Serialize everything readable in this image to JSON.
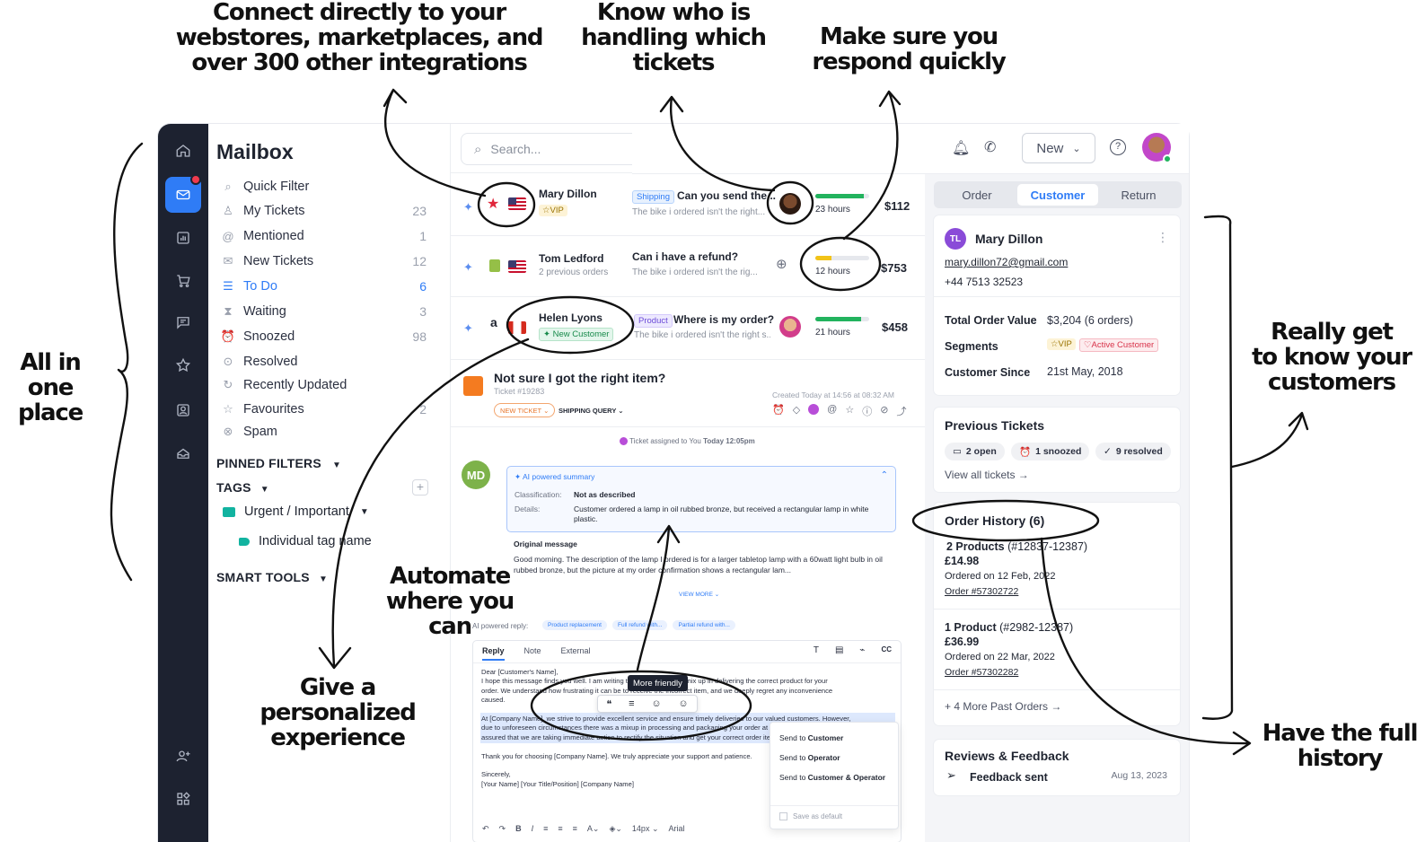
{
  "callouts": {
    "integrations": [
      "Connect directly to your",
      "webstores, marketplaces, and",
      "over 300 other integrations"
    ],
    "handling": [
      "Know who is",
      "handling which",
      "tickets"
    ],
    "respond": [
      "Make sure you",
      "respond quickly"
    ],
    "all_in_one": [
      "All in one",
      "place"
    ],
    "really_know": [
      "Really get",
      "to know your",
      "customers"
    ],
    "automate": [
      "Automate",
      "where you can"
    ],
    "personalized": [
      "Give a",
      "personalized",
      "experience"
    ],
    "full_history": [
      "Have the full",
      "history"
    ]
  },
  "mailbox": {
    "title": "Mailbox",
    "items": [
      {
        "icon": "search-icon",
        "label": "Quick Filter",
        "count": ""
      },
      {
        "icon": "user-icon",
        "label": "My Tickets",
        "count": "23"
      },
      {
        "icon": "at-icon",
        "label": "Mentioned",
        "count": "1"
      },
      {
        "icon": "mail-icon",
        "label": "New Tickets",
        "count": "12"
      },
      {
        "icon": "list-icon",
        "label": "To Do",
        "count": "6"
      },
      {
        "icon": "hourglass-icon",
        "label": "Waiting",
        "count": "3"
      },
      {
        "icon": "alarm-icon",
        "label": "Snoozed",
        "count": "98"
      },
      {
        "icon": "check-circle-icon",
        "label": "Resolved",
        "count": ""
      },
      {
        "icon": "history-icon",
        "label": "Recently Updated",
        "count": ""
      },
      {
        "icon": "star-icon",
        "label": "Favourites",
        "count": "2"
      },
      {
        "icon": "ban-icon",
        "label": "Spam",
        "count": ""
      }
    ],
    "selected_index": 4,
    "pinned_filters": "PINNED FILTERS",
    "tags": "TAGS",
    "tag_items": [
      "Urgent / Important",
      "Individual tag name"
    ],
    "smart_tools": "SMART TOOLS"
  },
  "search": {
    "placeholder": "Search..."
  },
  "header": {
    "new_button": "New"
  },
  "tickets": [
    {
      "name": "Mary Dillon",
      "badge": "VIP",
      "tag": "Shipping",
      "subject": "Can you send the...",
      "preview": "The bike i ordered isn't the right...",
      "sla": "23 hours",
      "sla_fill": 0.9,
      "sla_color": "#22b35e",
      "price": "$112"
    },
    {
      "name": "Tom Ledford",
      "sub": "2 previous orders",
      "subject": "Can i have a refund?",
      "preview": "The bike i ordered isn't the rig...",
      "sla": "12 hours",
      "sla_fill": 0.3,
      "sla_color": "#f2c318",
      "price": "$753"
    },
    {
      "name": "Helen Lyons",
      "badge": "New Customer",
      "tag": "Product",
      "subject": "Where is my order?",
      "preview": "The bike i ordered isn't the right s...",
      "sla": "21 hours",
      "sla_fill": 0.85,
      "sla_color": "#22b35e",
      "price": "$458"
    }
  ],
  "open_ticket": {
    "title": "Not sure I got the right item?",
    "number": "Ticket #19283",
    "created": "Created Today at 14:56 at 08:32 AM",
    "status": "NEW TICKET",
    "category": "SHIPPING QUERY",
    "assigned": "Ticket assigned to You",
    "assigned_time": "Today 12:05pm",
    "author_initials": "MD",
    "summary_title": "AI powered summary",
    "classification_label": "Classification:",
    "classification_value": "Not as described",
    "details_label": "Details:",
    "details_value": "Customer ordered a lamp in oil rubbed bronze, but received a rectangular lamp in white plastic.",
    "original_label": "Original message",
    "original_text": "Good morning. The description of the lamp I ordered is for a larger tabletop lamp with a 60watt light bulb in oil rubbed bronze, but the picture at my order confirmation shows a rectangular lam...",
    "view_more": "VIEW MORE",
    "ai_reply_label": "AI powered reply:",
    "ai_chips": [
      "Product replacement",
      "Full refund with...",
      "Partial refund with..."
    ],
    "reply_tabs": [
      "Reply",
      "Note",
      "External"
    ],
    "reply_lines": [
      "Dear [Customer's Name],",
      "I hope this message finds you well. I am writing to apologize for the mix up in delivering the correct product for your",
      "order. We understand how frustrating it can be to receive the incorrect item, and we deeply regret any inconvenience",
      "caused.",
      "",
      "At [Company Name], we strive to provide excellent service and ensure timely deliveries to our valued customers. However,",
      "due to unforeseen circumstances there was a mixup in processing and packaging your order at our warehouse. Please be",
      "assured that we are taking immediate action to rectify the situation and get your correct order item to you as soon as possible.",
      "",
      "Thank you for choosing [Company Name]. We truly appreciate your support and patience.",
      "",
      "Sincerely,",
      "[Your Name] [Your Title/Position] [Company Name]"
    ],
    "tooltip": "More friendly",
    "send_options": [
      {
        "prefix": "Send to ",
        "target": "Customer"
      },
      {
        "prefix": "Send to ",
        "target": "Operator"
      },
      {
        "prefix": "Send to ",
        "target": "Customer & Operator"
      }
    ],
    "save_default": "Save as default",
    "font_size": "14px",
    "font_name": "Arial"
  },
  "right_tabs": [
    "Order",
    "Customer",
    "Return"
  ],
  "customer": {
    "initials": "TL",
    "name": "Mary Dillon",
    "email": "mary.dillon72@gmail.com",
    "phone": "+44 7513 32523",
    "total_label": "Total Order Value",
    "total_value": "$3,204 (6 orders)",
    "segments_label": "Segments",
    "segment_1": "VIP",
    "segment_2": "Active Customer",
    "since_label": "Customer Since",
    "since_value": "21st May, 2018"
  },
  "previous_tickets": {
    "title": "Previous Tickets",
    "pills": [
      "2 open",
      "1 snoozed",
      "9 resolved"
    ],
    "link": "View all tickets →"
  },
  "order_history": {
    "title": "Order History (6)",
    "orders": [
      {
        "products": "2 Products",
        "range": "(#12837-12387)",
        "price": "£14.98",
        "date": "Ordered on 12 Feb, 2022",
        "order": "Order #57302722"
      },
      {
        "products": "1 Product",
        "range": "(#2982-12387)",
        "price": "£36.99",
        "date": "Ordered on 22 Mar, 2022",
        "order": "Order #57302282"
      }
    ],
    "more": "+ 4 More Past Orders →"
  },
  "reviews": {
    "title": "Reviews & Feedback",
    "item": "Feedback sent",
    "date": "Aug 13, 2023"
  },
  "colors": {
    "accent": "#2f7cf6",
    "nav": "#1d2230",
    "green": "#22b35e",
    "amber": "#f2c318",
    "alert": "#ef3b4e"
  }
}
